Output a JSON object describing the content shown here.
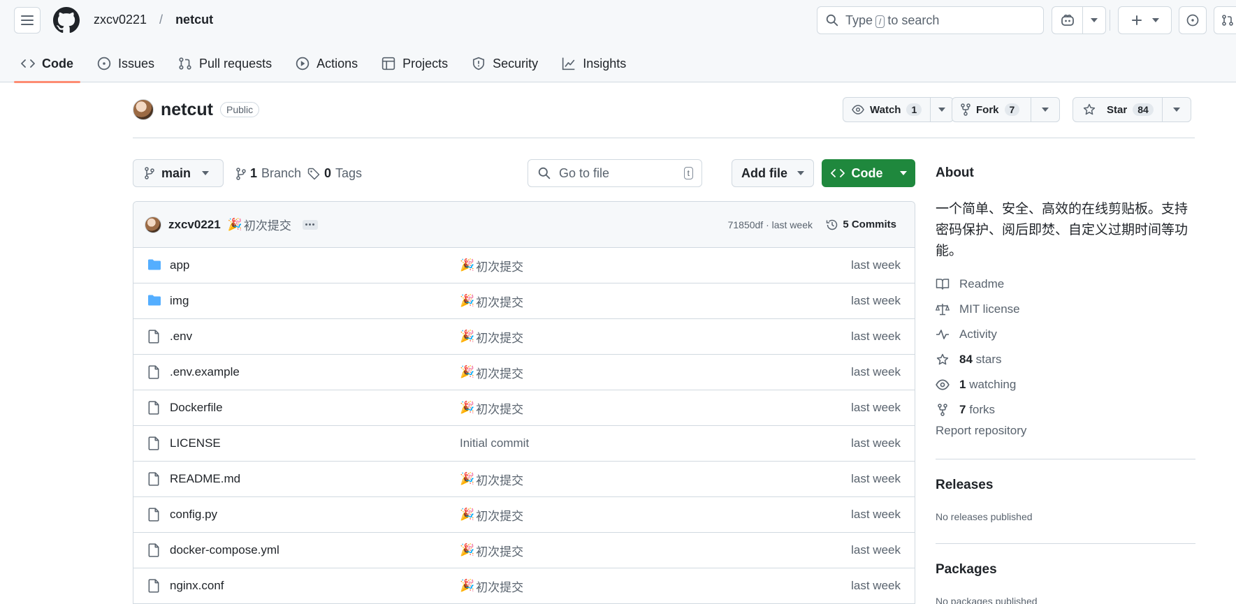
{
  "header": {
    "owner": "zxcv0221",
    "separator": "/",
    "repo": "netcut",
    "search": {
      "prefix": "Type",
      "key": "/",
      "suffix": "to search"
    }
  },
  "tabs": [
    {
      "label": "Code",
      "icon": "code-icon",
      "active": true
    },
    {
      "label": "Issues",
      "icon": "issue-icon"
    },
    {
      "label": "Pull requests",
      "icon": "pull-request-icon"
    },
    {
      "label": "Actions",
      "icon": "play-icon"
    },
    {
      "label": "Projects",
      "icon": "table-icon"
    },
    {
      "label": "Security",
      "icon": "shield-icon"
    },
    {
      "label": "Insights",
      "icon": "graph-icon"
    }
  ],
  "repo": {
    "name": "netcut",
    "visibility": "Public",
    "watch": {
      "label": "Watch",
      "count": "1"
    },
    "fork": {
      "label": "Fork",
      "count": "7"
    },
    "star": {
      "label": "Star",
      "count": "84"
    }
  },
  "filenav": {
    "branch": "main",
    "branches": {
      "count": "1",
      "label": "Branch"
    },
    "tags": {
      "count": "0",
      "label": "Tags"
    },
    "goto_placeholder": "Go to file",
    "goto_key": "t",
    "add_file": "Add file",
    "code": "Code"
  },
  "commit": {
    "author": "zxcv0221",
    "emoji": "🎉",
    "message": "初次提交",
    "hash_time": "71850df · last week",
    "commits": "5 Commits"
  },
  "files": [
    {
      "name": "app",
      "type": "dir",
      "message": "初次提交",
      "emoji": "🎉",
      "date": "last week"
    },
    {
      "name": "img",
      "type": "dir",
      "message": "初次提交",
      "emoji": "🎉",
      "date": "last week"
    },
    {
      "name": ".env",
      "type": "file",
      "message": "初次提交",
      "emoji": "🎉",
      "date": "last week"
    },
    {
      "name": ".env.example",
      "type": "file",
      "message": "初次提交",
      "emoji": "🎉",
      "date": "last week"
    },
    {
      "name": "Dockerfile",
      "type": "file",
      "message": "初次提交",
      "emoji": "🎉",
      "date": "last week"
    },
    {
      "name": "LICENSE",
      "type": "file",
      "message": "Initial commit",
      "emoji": "",
      "date": "last week"
    },
    {
      "name": "README.md",
      "type": "file",
      "message": "初次提交",
      "emoji": "🎉",
      "date": "last week"
    },
    {
      "name": "config.py",
      "type": "file",
      "message": "初次提交",
      "emoji": "🎉",
      "date": "last week"
    },
    {
      "name": "docker-compose.yml",
      "type": "file",
      "message": "初次提交",
      "emoji": "🎉",
      "date": "last week"
    },
    {
      "name": "nginx.conf",
      "type": "file",
      "message": "初次提交",
      "emoji": "🎉",
      "date": "last week"
    }
  ],
  "about": {
    "title": "About",
    "description": "一个简单、安全、高效的在线剪贴板。支持密码保护、阅后即焚、自定义过期时间等功能。",
    "readme": "Readme",
    "license": "MIT license",
    "activity": "Activity",
    "stars": {
      "count": "84",
      "label": "stars"
    },
    "watching": {
      "count": "1",
      "label": "watching"
    },
    "forks": {
      "count": "7",
      "label": "forks"
    },
    "report": "Report repository"
  },
  "releases": {
    "title": "Releases",
    "note": "No releases published"
  },
  "packages": {
    "title": "Packages",
    "note": "No packages published"
  },
  "colors": {
    "accent_green": "#1f883d",
    "tab_underline": "#fd8c73",
    "folder_blue": "#54aeff"
  }
}
